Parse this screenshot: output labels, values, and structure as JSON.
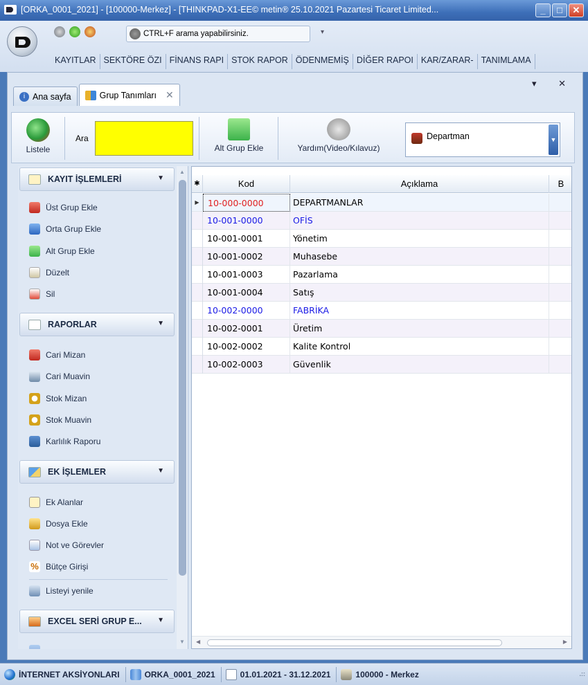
{
  "window": {
    "title": "[ORKA_0001_2021]  -  [100000-Merkez]  -  [THINKPAD-X1-EE© metin® 25.10.2021 Pazartesi Ticaret Limited...",
    "min": "_",
    "max": "□",
    "close": "✕"
  },
  "quick": {
    "search_text": "CTRL+F arama yapabilirsiniz.",
    "dropdown": "▾"
  },
  "menu": [
    "KAYITLAR",
    "SEKTÖRE ÖZI",
    "FİNANS RAPI",
    "STOK RAPOR",
    "ÖDENMEMİŞ",
    "DİĞER RAPOI",
    "KAR/ZARAR-",
    "TANIMLAMA"
  ],
  "tabs": {
    "home": "Ana sayfa",
    "active": "Grup Tanımları",
    "close": "✕",
    "controls": "▾ ✕"
  },
  "toolbar": {
    "listele": "Listele",
    "ara_label": "Ara",
    "ara_value": "",
    "alt_grup_ekle": "Alt Grup Ekle",
    "yardim": "Yardım(Video/Kılavuz)",
    "selector": "Departman"
  },
  "left": {
    "kayit_title": "KAYIT İŞLEMLERİ",
    "kayit_items": [
      "Üst Grup Ekle",
      "Orta Grup Ekle",
      "Alt Grup Ekle",
      "Düzelt",
      "Sil"
    ],
    "rapor_title": "RAPORLAR",
    "rapor_items": [
      "Cari Mizan",
      "Cari Muavin",
      "Stok Mizan",
      "Stok Muavin",
      "Karlılık Raporu"
    ],
    "ek_title": "EK İŞLEMLER",
    "ek_items": [
      "Ek Alanlar",
      "Dosya Ekle",
      "Not ve Görevler",
      "Bütçe Girişi"
    ],
    "yenile": "Listeyi yenile",
    "excel_title": "EXCEL SERİ GRUP E..."
  },
  "grid": {
    "headers": [
      "Kod",
      "Açıklama",
      "B"
    ],
    "rows": [
      {
        "kod": "10-000-0000",
        "aciklama": "DEPARTMANLAR"
      },
      {
        "kod": "10-001-0000",
        "aciklama": "OFİS"
      },
      {
        "kod": "10-001-0001",
        "aciklama": "Yönetim"
      },
      {
        "kod": "10-001-0002",
        "aciklama": "Muhasebe"
      },
      {
        "kod": "10-001-0003",
        "aciklama": "Pazarlama"
      },
      {
        "kod": "10-001-0004",
        "aciklama": "Satış"
      },
      {
        "kod": "10-002-0000",
        "aciklama": "FABRİKA"
      },
      {
        "kod": "10-002-0001",
        "aciklama": "Üretim"
      },
      {
        "kod": "10-002-0002",
        "aciklama": "Kalite Kontrol"
      },
      {
        "kod": "10-002-0003",
        "aciklama": "Güvenlik"
      }
    ]
  },
  "status": {
    "internet": "İNTERNET AKSİYONLARI",
    "db": "ORKA_0001_2021",
    "period": "01.01.2021 - 31.12.2021",
    "branch": "100000 - Merkez"
  },
  "colors": {
    "highlight_red": "#e02020",
    "highlight_blue": "#1a1ae6",
    "search_yellow": "#ffff00"
  }
}
